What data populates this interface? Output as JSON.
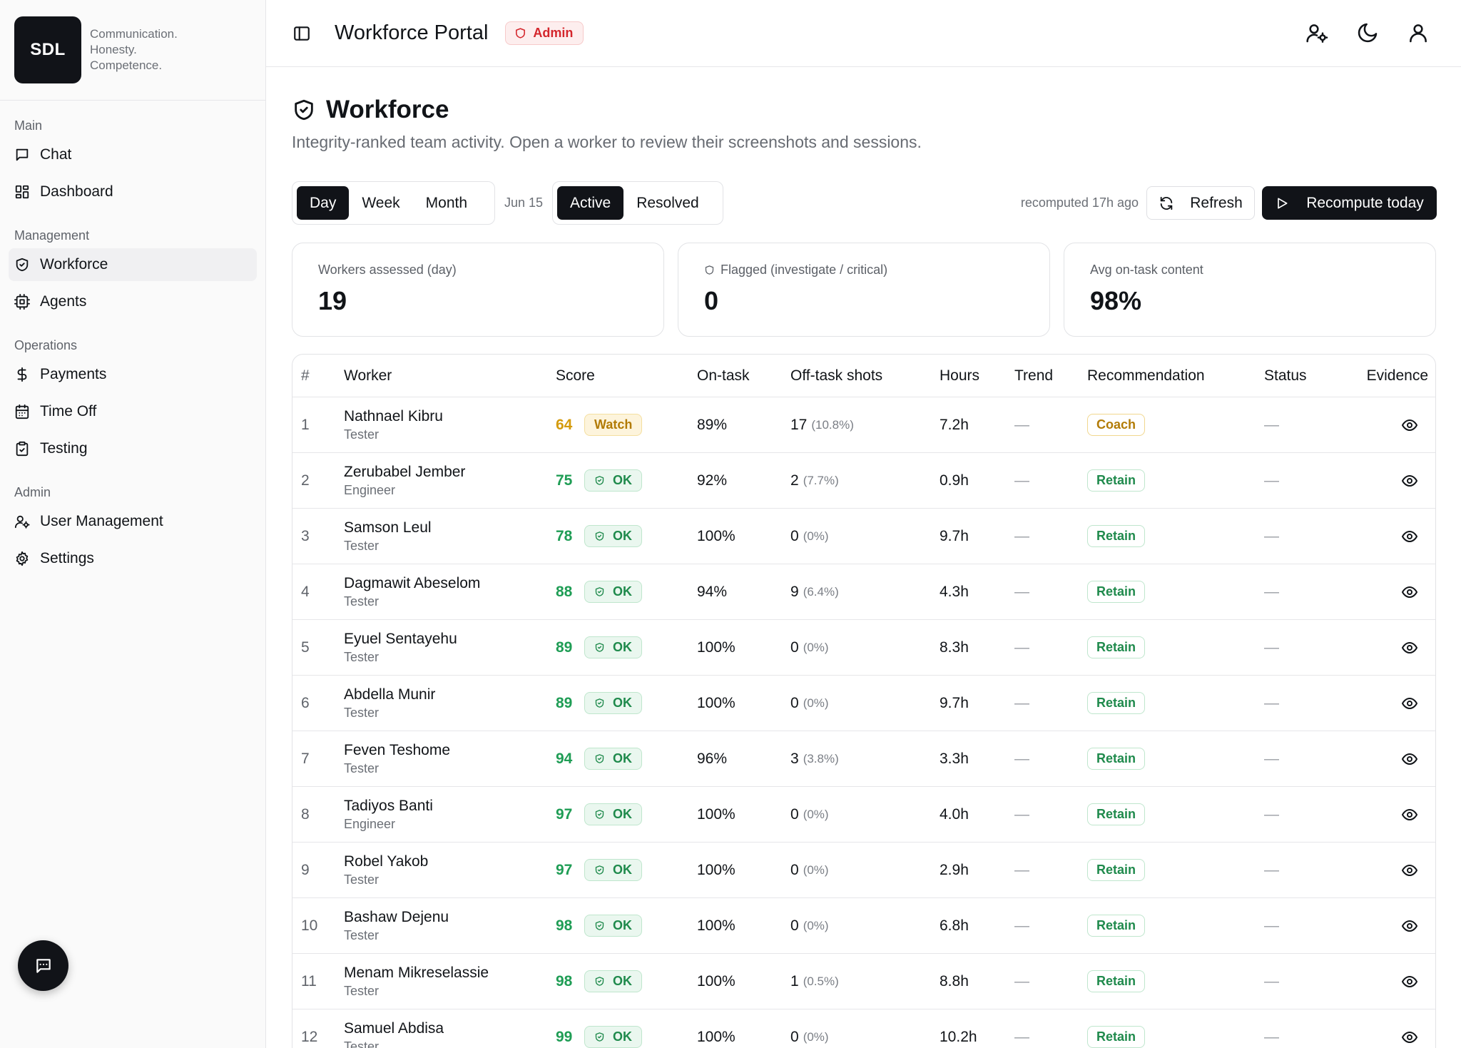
{
  "brand": {
    "logo_text": "SDL",
    "tagline": [
      "Communication.",
      "Honesty.",
      "Competence."
    ]
  },
  "sidebar": {
    "sections": [
      {
        "title": "Main",
        "items": [
          {
            "label": "Chat",
            "icon": "chat-icon"
          },
          {
            "label": "Dashboard",
            "icon": "dashboard-icon"
          }
        ]
      },
      {
        "title": "Management",
        "items": [
          {
            "label": "Workforce",
            "icon": "shield-icon",
            "active": true
          },
          {
            "label": "Agents",
            "icon": "bot-icon"
          }
        ]
      },
      {
        "title": "Operations",
        "items": [
          {
            "label": "Payments",
            "icon": "dollar-icon"
          },
          {
            "label": "Time Off",
            "icon": "calendar-icon"
          },
          {
            "label": "Testing",
            "icon": "clipboard-check-icon"
          }
        ]
      },
      {
        "title": "Admin",
        "items": [
          {
            "label": "User Management",
            "icon": "user-cog-icon"
          },
          {
            "label": "Settings",
            "icon": "gear-icon"
          }
        ]
      }
    ]
  },
  "topbar": {
    "title": "Workforce Portal",
    "role_badge": "Admin"
  },
  "page": {
    "title": "Workforce",
    "subtitle": "Integrity-ranked team activity. Open a worker to review their screenshots and sessions."
  },
  "toolbar": {
    "periods": [
      {
        "label": "Day",
        "active": true
      },
      {
        "label": "Week",
        "active": false
      },
      {
        "label": "Month",
        "active": false
      }
    ],
    "date": "Jun 15",
    "states": [
      {
        "label": "Active",
        "active": true
      },
      {
        "label": "Resolved",
        "active": false
      }
    ],
    "recomputed": "recomputed 17h ago",
    "refresh_label": "Refresh",
    "recompute_label": "Recompute today"
  },
  "stats": [
    {
      "label": "Workers assessed (day)",
      "value": "19",
      "icon": ""
    },
    {
      "label": "Flagged (investigate / critical)",
      "value": "0",
      "icon": "shield-icon"
    },
    {
      "label": "Avg on-task content",
      "value": "98%",
      "icon": ""
    }
  ],
  "table": {
    "headers": {
      "idx": "#",
      "worker": "Worker",
      "score": "Score",
      "ontask": "On-task",
      "off": "Off-task shots",
      "hours": "Hours",
      "trend": "Trend",
      "rec": "Recommendation",
      "status": "Status",
      "evidence": "Evidence"
    },
    "rows": [
      {
        "idx": "1",
        "name": "Nathnael Kibru",
        "role": "Tester",
        "score": "64",
        "badge": "Watch",
        "level": "watch",
        "ontask": "89%",
        "off": "17",
        "off_pct": "(10.8%)",
        "hours": "7.2h",
        "trend": "—",
        "rec": "Coach",
        "status": "—"
      },
      {
        "idx": "2",
        "name": "Zerubabel Jember",
        "role": "Engineer",
        "score": "75",
        "badge": "OK",
        "level": "ok",
        "ontask": "92%",
        "off": "2",
        "off_pct": "(7.7%)",
        "hours": "0.9h",
        "trend": "—",
        "rec": "Retain",
        "status": "—"
      },
      {
        "idx": "3",
        "name": "Samson Leul",
        "role": "Tester",
        "score": "78",
        "badge": "OK",
        "level": "ok",
        "ontask": "100%",
        "off": "0",
        "off_pct": "(0%)",
        "hours": "9.7h",
        "trend": "—",
        "rec": "Retain",
        "status": "—"
      },
      {
        "idx": "4",
        "name": "Dagmawit Abeselom",
        "role": "Tester",
        "score": "88",
        "badge": "OK",
        "level": "ok",
        "ontask": "94%",
        "off": "9",
        "off_pct": "(6.4%)",
        "hours": "4.3h",
        "trend": "—",
        "rec": "Retain",
        "status": "—"
      },
      {
        "idx": "5",
        "name": "Eyuel Sentayehu",
        "role": "Tester",
        "score": "89",
        "badge": "OK",
        "level": "ok",
        "ontask": "100%",
        "off": "0",
        "off_pct": "(0%)",
        "hours": "8.3h",
        "trend": "—",
        "rec": "Retain",
        "status": "—"
      },
      {
        "idx": "6",
        "name": "Abdella Munir",
        "role": "Tester",
        "score": "89",
        "badge": "OK",
        "level": "ok",
        "ontask": "100%",
        "off": "0",
        "off_pct": "(0%)",
        "hours": "9.7h",
        "trend": "—",
        "rec": "Retain",
        "status": "—"
      },
      {
        "idx": "7",
        "name": "Feven Teshome",
        "role": "Tester",
        "score": "94",
        "badge": "OK",
        "level": "ok",
        "ontask": "96%",
        "off": "3",
        "off_pct": "(3.8%)",
        "hours": "3.3h",
        "trend": "—",
        "rec": "Retain",
        "status": "—"
      },
      {
        "idx": "8",
        "name": "Tadiyos Banti",
        "role": "Engineer",
        "score": "97",
        "badge": "OK",
        "level": "ok",
        "ontask": "100%",
        "off": "0",
        "off_pct": "(0%)",
        "hours": "4.0h",
        "trend": "—",
        "rec": "Retain",
        "status": "—"
      },
      {
        "idx": "9",
        "name": "Robel Yakob",
        "role": "Tester",
        "score": "97",
        "badge": "OK",
        "level": "ok",
        "ontask": "100%",
        "off": "0",
        "off_pct": "(0%)",
        "hours": "2.9h",
        "trend": "—",
        "rec": "Retain",
        "status": "—"
      },
      {
        "idx": "10",
        "name": "Bashaw Dejenu",
        "role": "Tester",
        "score": "98",
        "badge": "OK",
        "level": "ok",
        "ontask": "100%",
        "off": "0",
        "off_pct": "(0%)",
        "hours": "6.8h",
        "trend": "—",
        "rec": "Retain",
        "status": "—"
      },
      {
        "idx": "11",
        "name": "Menam Mikreselassie",
        "role": "Tester",
        "score": "98",
        "badge": "OK",
        "level": "ok",
        "ontask": "100%",
        "off": "1",
        "off_pct": "(0.5%)",
        "hours": "8.8h",
        "trend": "—",
        "rec": "Retain",
        "status": "—"
      },
      {
        "idx": "12",
        "name": "Samuel Abdisa",
        "role": "Tester",
        "score": "99",
        "badge": "OK",
        "level": "ok",
        "ontask": "100%",
        "off": "0",
        "off_pct": "(0%)",
        "hours": "10.2h",
        "trend": "—",
        "rec": "Retain",
        "status": "—"
      }
    ]
  },
  "colors": {
    "dark": "#111318",
    "ok_green": "#1f9d55",
    "watch_amber": "#d49b0d",
    "admin_red": "#d4262c"
  }
}
